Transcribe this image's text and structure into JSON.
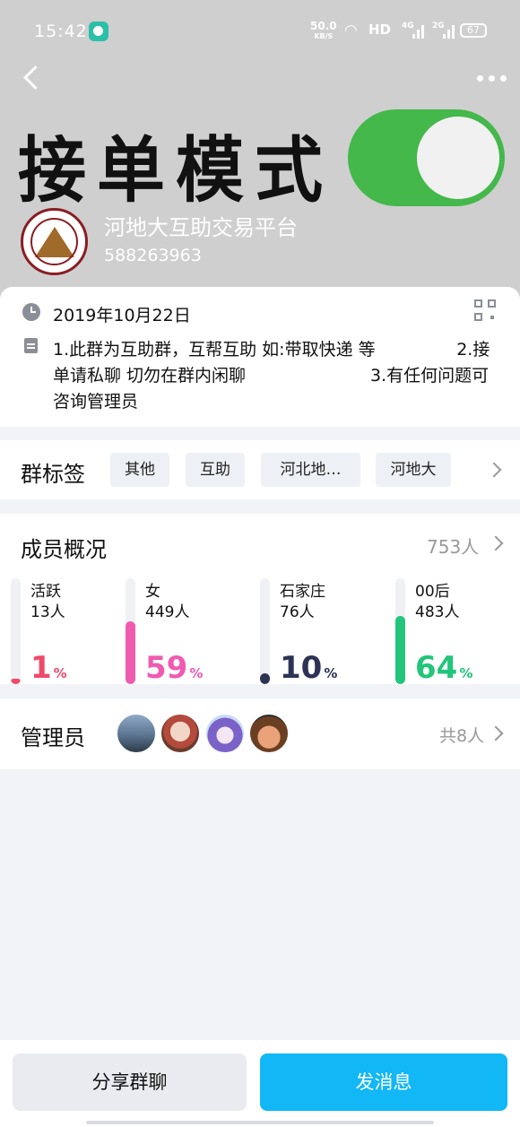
{
  "status_bar": {
    "time": "15:42",
    "speed_value": "50.0",
    "speed_unit": "KB/S",
    "hd": "HD",
    "signal_1": "4G",
    "signal_2": "2G",
    "battery": "67"
  },
  "header": {
    "banner_text": "接单模式",
    "group_name": "河地大互助交易平台",
    "group_id": "588263963"
  },
  "info": {
    "date": "2019年10月22日",
    "notice": "1.此群为互助群，互帮互助 如:带取快递 等               2.接单请私聊 切勿在群内闲聊                       3.有任何问题可咨询管理员"
  },
  "tags": {
    "title": "群标签",
    "items": [
      "其他",
      "互助",
      "河北地…",
      "河地大"
    ]
  },
  "members": {
    "title": "成员概况",
    "count": "753人",
    "stats": [
      {
        "label": "活跃",
        "sub": "13人",
        "value": "1",
        "unit": "%",
        "fraction": 0.01,
        "color": "#f04a6a"
      },
      {
        "label": "女",
        "sub": "449人",
        "value": "59",
        "unit": "%",
        "fraction": 0.59,
        "color": "#f05ab0"
      },
      {
        "label": "石家庄",
        "sub": "76人",
        "value": "10",
        "unit": "%",
        "fraction": 0.1,
        "color": "#2d3354"
      },
      {
        "label": "00后",
        "sub": "483人",
        "value": "64",
        "unit": "%",
        "fraction": 0.64,
        "color": "#22c57a"
      }
    ]
  },
  "admins": {
    "title": "管理员",
    "total": "共8人"
  },
  "actions": {
    "share": "分享群聊",
    "send": "发消息"
  }
}
